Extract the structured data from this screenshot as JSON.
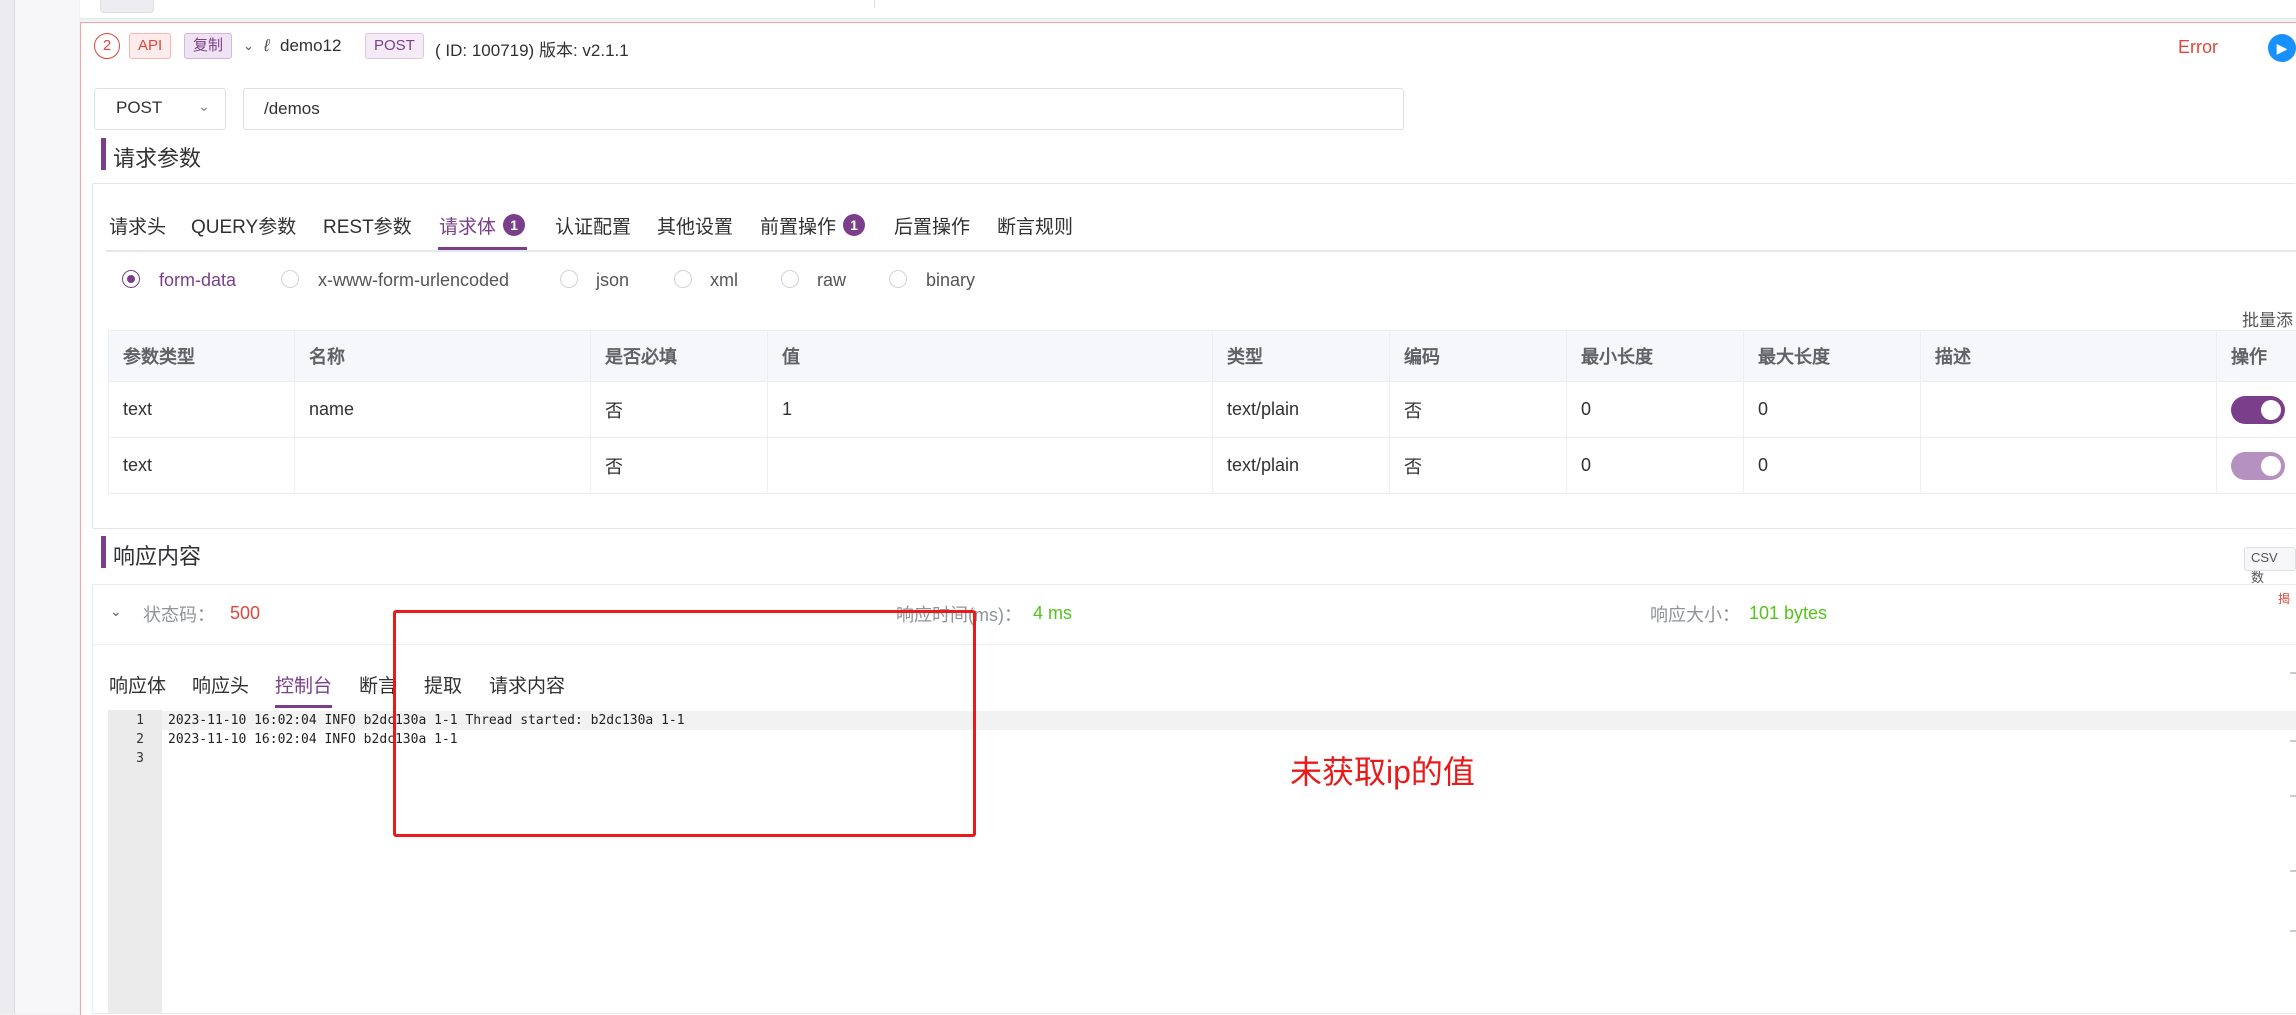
{
  "header": {
    "step_number": "2",
    "api_tag": "API",
    "copy_tag": "复制",
    "api_name": "demo12",
    "method_tag": "POST",
    "id_version": "( ID: 100719)  版本: v2.1.1",
    "status": "Error"
  },
  "request": {
    "method": "POST",
    "url": "/demos"
  },
  "params_section": {
    "title": "请求参数",
    "tabs": [
      {
        "label": "请求头"
      },
      {
        "label": "QUERY参数"
      },
      {
        "label": "REST参数"
      },
      {
        "label": "请求体",
        "badge": "1"
      },
      {
        "label": "认证配置"
      },
      {
        "label": "其他设置"
      },
      {
        "label": "前置操作",
        "badge": "1"
      },
      {
        "label": "后置操作"
      },
      {
        "label": "断言规则"
      }
    ],
    "active_tab": "请求体",
    "body_types": [
      "form-data",
      "x-www-form-urlencoded",
      "json",
      "xml",
      "raw",
      "binary"
    ],
    "selected_body_type": "form-data",
    "batch_label": "批量添",
    "table": {
      "columns": [
        "参数类型",
        "名称",
        "是否必填",
        "值",
        "类型",
        "编码",
        "最小长度",
        "最大长度",
        "描述",
        "操作"
      ],
      "rows": [
        {
          "param_type": "text",
          "name": "name",
          "required": "否",
          "value": "1",
          "content_type": "text/plain",
          "encode": "否",
          "min_len": "0",
          "max_len": "0",
          "desc": "",
          "enabled": true
        },
        {
          "param_type": "text",
          "name": "",
          "required": "否",
          "value": "",
          "content_type": "text/plain",
          "encode": "否",
          "min_len": "0",
          "max_len": "0",
          "desc": "",
          "enabled": true
        }
      ]
    }
  },
  "response_section": {
    "title": "响应内容",
    "csv_label": "CSV 数",
    "status_label": "状态码：",
    "status_value": "500",
    "time_label": "响应时间(ms)：",
    "time_value": "4 ms",
    "size_label": "响应大小：",
    "size_value": "101 bytes",
    "side_tag": "揭",
    "tabs": [
      "响应体",
      "响应头",
      "控制台",
      "断言",
      "提取",
      "请求内容"
    ],
    "active_tab": "控制台",
    "console": [
      {
        "line": "1",
        "text": "2023-11-10 16:02:04 INFO b2dc130a 1-1 Thread started: b2dc130a 1-1"
      },
      {
        "line": "2",
        "text": "2023-11-10 16:02:04 INFO b2dc130a 1-1"
      },
      {
        "line": "3",
        "text": ""
      }
    ]
  },
  "annotation": {
    "text": "未获取ip的值",
    "color": "#e81a1a"
  },
  "colors": {
    "accent": "#7a3e8a",
    "error": "#e0463b",
    "success": "#52c41a"
  }
}
